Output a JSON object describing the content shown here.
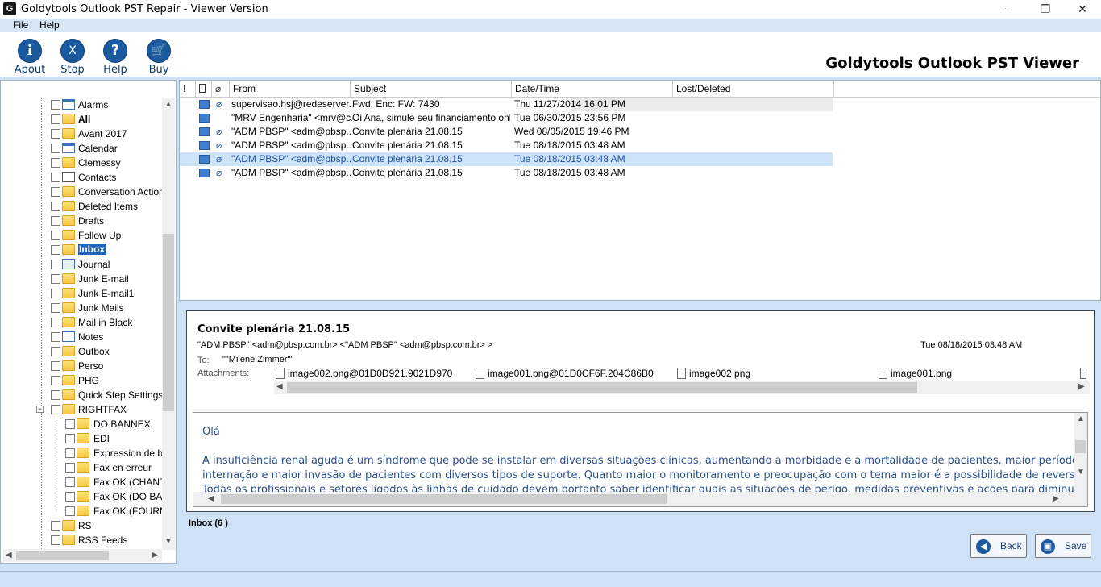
{
  "window": {
    "title": "Goldytools Outlook PST Repair - Viewer Version",
    "minimize": "–",
    "maximize": "❐",
    "close": "✕",
    "app_icon": "G"
  },
  "menu": [
    "File",
    "Help"
  ],
  "toolbar": {
    "about": "About",
    "stop": "Stop",
    "help": "Help",
    "buy": "Buy",
    "about_glyph": "i",
    "stop_glyph": "X",
    "help_glyph": "?",
    "buy_glyph": "🛒"
  },
  "brand": "Goldytools Outlook PST Viewer",
  "tree": {
    "items": [
      "Alarms",
      "All",
      "Avant 2017",
      "Calendar",
      "Clemessy",
      "Contacts",
      "Conversation Action",
      "Deleted Items",
      "Drafts",
      "Follow Up",
      "Inbox",
      "Journal",
      "Junk E-mail",
      "Junk E-mail1",
      "Junk Mails",
      "Mail in Black",
      "Notes",
      "Outbox",
      "Perso",
      "PHG",
      "Quick Step Settings",
      "RIGHTFAX",
      "DO BANNEX",
      "EDI",
      "Expression de be",
      "Fax en erreur",
      "Fax OK (CHANT",
      "Fax OK (DO BAN",
      "Fax OK (FOURNI",
      "RS",
      "RSS Feeds"
    ],
    "selected": "Inbox",
    "collapse": "−"
  },
  "list": {
    "columns": {
      "importance": "!",
      "type": "",
      "attach": "",
      "from": "From",
      "subject": "Subject",
      "date": "Date/Time",
      "lost": "Lost/Deleted"
    },
    "rows": [
      {
        "from": "supervisao.hsj@redeserver...",
        "subject": "Fwd: Enc: FW: 7430",
        "date": "Thu 11/27/2014 16:01 PM"
      },
      {
        "from": "\"MRV Engenharia\" <mrv@c...",
        "subject": "Oi Ana, simule seu financiamento online.",
        "date": "Tue 06/30/2015 23:56 PM"
      },
      {
        "from": "\"ADM PBSP\" <adm@pbsp....",
        "subject": "Convite plenária 21.08.15",
        "date": "Wed 08/05/2015 19:46 PM"
      },
      {
        "from": "\"ADM PBSP\" <adm@pbsp....",
        "subject": "Convite plenária 21.08.15",
        "date": "Tue 08/18/2015 03:48 AM"
      },
      {
        "from": "\"ADM PBSP\" <adm@pbsp....",
        "subject": "Convite plenária 21.08.15",
        "date": "Tue 08/18/2015 03:48 AM"
      },
      {
        "from": "\"ADM PBSP\" <adm@pbsp....",
        "subject": "Convite plenária 21.08.15",
        "date": "Tue 08/18/2015 03:48 AM"
      }
    ]
  },
  "preview": {
    "subject": "Convite plenária 21.08.15",
    "from": "\"ADM PBSP\" <adm@pbsp.com.br> <\"ADM PBSP\" <adm@pbsp.com.br> >",
    "date": "Tue 08/18/2015 03:48 AM",
    "to_label": "To:",
    "to": "\"\"Milene Zimmer\"\"",
    "attachments_label": "Attachments:",
    "attachments": [
      "image002.png@01D0D921.9021D970",
      "image001.png@01D0CF6F.204C86B0",
      "image002.png",
      "image001.png"
    ],
    "body": [
      "Olá",
      "A insuficiência renal aguda é um síndrome que pode se instalar em diversas situações clínicas, aumentando a morbidade e a mortalidade de pacientes, maior período de",
      "internação e maior invasão de pacientes com diversos tipos de suporte. Quanto maior o monitoramento e preocupação com o tema maior é a possibilidade de reversão.",
      "Todas os profissionais e setores ligados às linhas de cuidado devem portanto saber identificar quais as situações de perigo, medidas preventivas e ações para diminuição do"
    ]
  },
  "status": "Inbox (6 )",
  "buttons": {
    "back": "Back",
    "save": "Save"
  }
}
